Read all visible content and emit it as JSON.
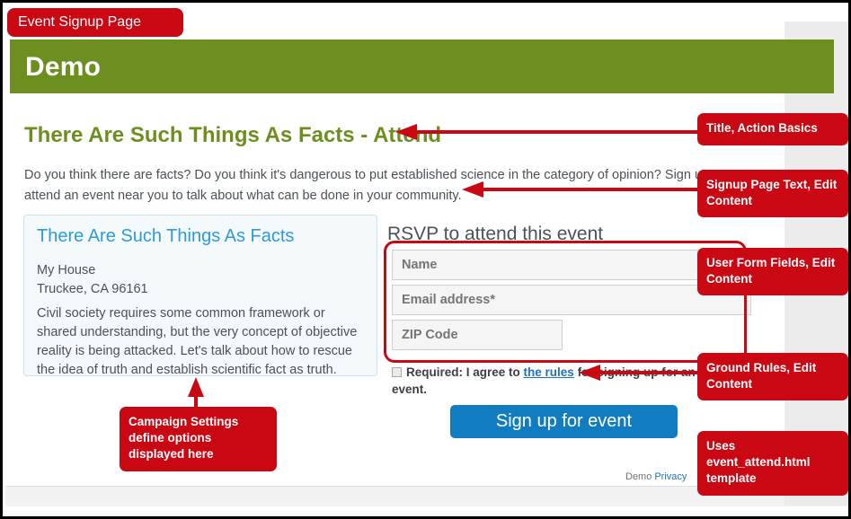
{
  "annotations": {
    "badge": "Event Signup Page",
    "title_basics": "Title, Action Basics",
    "signup_page_text": "Signup Page Text, Edit Content",
    "user_form_fields": "User Form Fields, Edit Content",
    "ground_rules": "Ground Rules, Edit Content",
    "template": "Uses event_attend.html template",
    "campaign_settings": "Campaign Settings define options displayed here"
  },
  "banner": {
    "title": "Demo"
  },
  "main": {
    "page_title": "There Are Such Things As Facts - Attend",
    "intro": "Do you think there are facts? Do you think it's dangerous to put established science in the category of opinion? Sign up to attend an event near you to talk about what can be done in your community."
  },
  "event_card": {
    "title": "There Are Such Things As Facts",
    "venue": "My House",
    "city_state_zip": "Truckee, CA 96161",
    "description": "Civil society requires some common framework or shared understanding, but the very concept of objective reality is being attacked. Let's talk about how to rescue the idea of truth and establish scientific fact as truth."
  },
  "rsvp": {
    "heading": "RSVP to attend this event",
    "fields": [
      {
        "name": "name",
        "placeholder": "Name"
      },
      {
        "name": "email",
        "placeholder": "Email address*"
      },
      {
        "name": "zip",
        "placeholder": "ZIP Code"
      }
    ],
    "rules_prefix": "Required: I agree to ",
    "rules_link": "the rules",
    "rules_suffix": " for signing up for an event.",
    "submit_label": "Sign up for event"
  },
  "footer": {
    "site_name": "Demo",
    "privacy_label": "Privacy"
  },
  "colors": {
    "annotation_red": "#ca0813",
    "banner_green": "#6d8f20",
    "title_green": "#6d8f20",
    "card_title_blue": "#2e9bd6",
    "button_blue": "#127cc1",
    "link_blue": "#2272b5"
  }
}
